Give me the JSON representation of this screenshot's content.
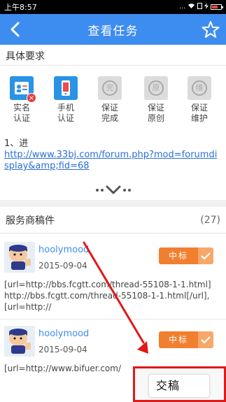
{
  "status_bar": {
    "time": "上午8:57",
    "icons_text": "... ⌔ ▮▮ ⚡"
  },
  "header": {
    "title": "查看任务",
    "back_icon": "chevron-left-icon",
    "star_icon": "star-outline-icon"
  },
  "requirements": {
    "section_title": "具体要求",
    "items": [
      {
        "line1": "实名",
        "line2": "认证",
        "icon": "id-card-icon",
        "style": "blue",
        "seal_char": "",
        "badge": "x"
      },
      {
        "line1": "手机",
        "line2": "认证",
        "icon": "phone-icon",
        "style": "blue",
        "seal_char": "",
        "badge": ""
      },
      {
        "line1": "保证",
        "line2": "完成",
        "icon": "seal-complete-icon",
        "style": "grey",
        "seal_char": "完",
        "badge": ""
      },
      {
        "line1": "保证",
        "line2": "原创",
        "icon": "seal-original-icon",
        "style": "grey",
        "seal_char": "原",
        "badge": ""
      },
      {
        "line1": "保证",
        "line2": "维护",
        "icon": "seal-maintain-icon",
        "style": "grey",
        "seal_char": "维",
        "badge": ""
      }
    ],
    "desc_prefix": "1、进",
    "link_text": "http://www.33bj.com/forum.php?mod=forumdisplay&amp;fid=68"
  },
  "submissions": {
    "section_title": "服务商稿件",
    "count": "(27)",
    "award_label": "中标",
    "entries": [
      {
        "username": "hoolymood",
        "date": "2015-09-04",
        "content": "[url=http://bbs.fcgtt.com/thread-55108-1-1.html]http://bbs.fcgtt.com/thread-55108-1-1.html[/url],[url=http://"
      },
      {
        "username": "hoolymood",
        "date": "2015-09-04",
        "content": "[url=http://www.bifuer.com/"
      }
    ]
  },
  "submit": {
    "label": "交稿"
  },
  "colors": {
    "primary": "#3d8cf0",
    "award": "#f08030",
    "annotation": "#e01818"
  }
}
